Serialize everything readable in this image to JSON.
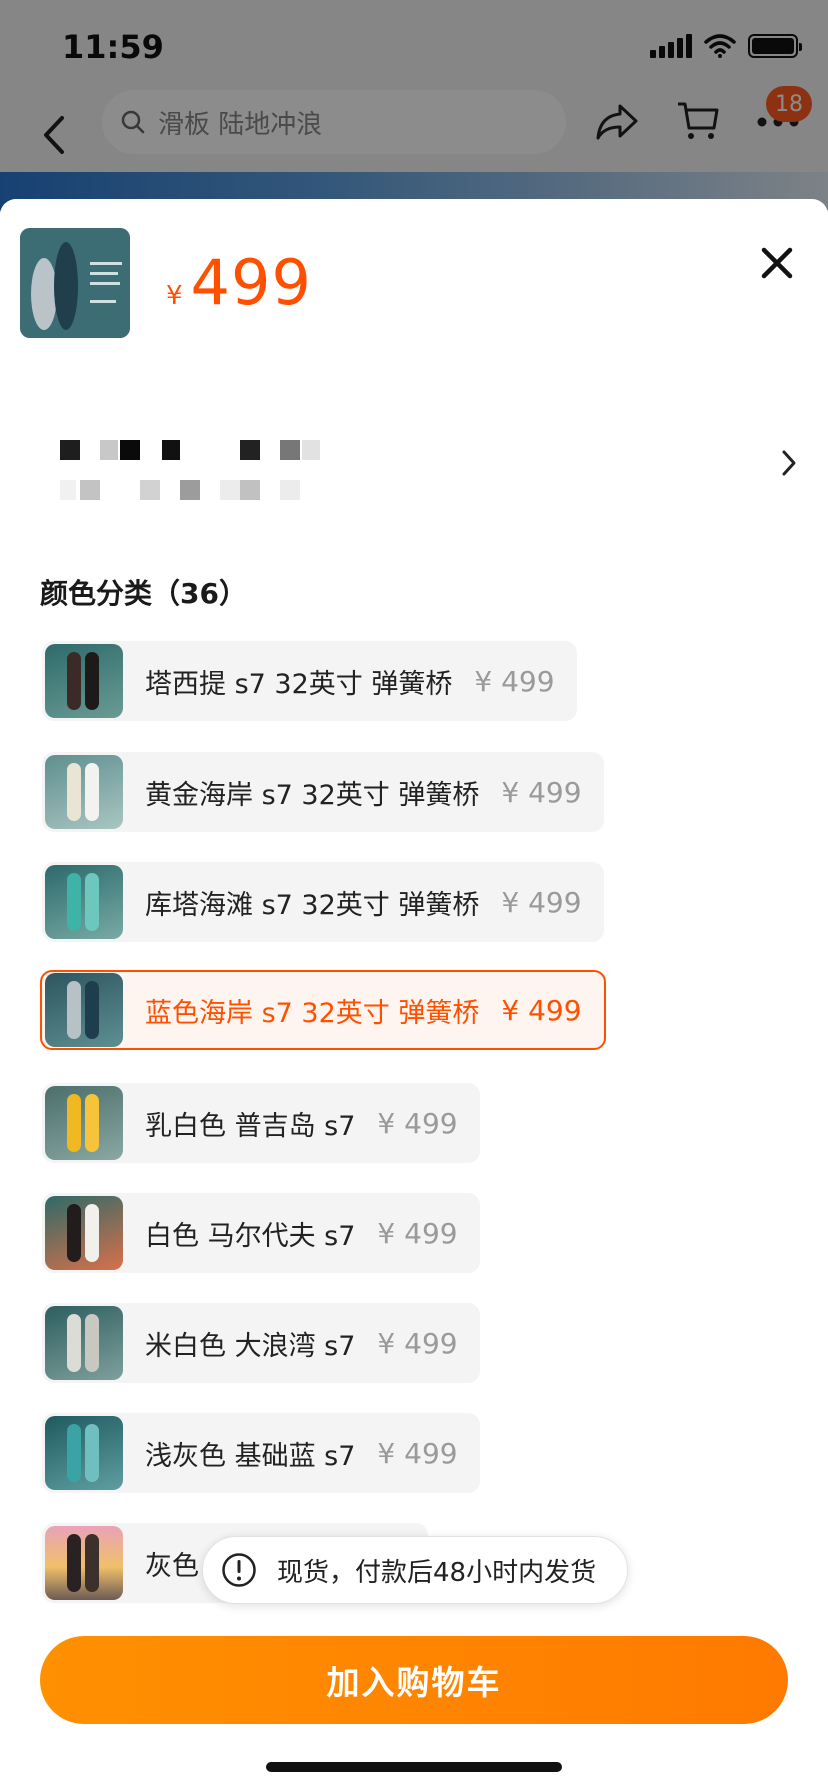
{
  "status_bar": {
    "time": "11:59"
  },
  "nav": {
    "search_placeholder": "滑板 陆地冲浪",
    "cart_badge": "18"
  },
  "product": {
    "currency": "¥",
    "price": "499",
    "thumb_label": "蓝色海岸"
  },
  "section_title": "颜色分类（36）",
  "options": [
    {
      "name": "塔西提 s7 32英寸 弹簧桥",
      "price": "¥ 499",
      "selected": false
    },
    {
      "name": "黄金海岸 s7 32英寸 弹簧桥",
      "price": "¥ 499",
      "selected": false
    },
    {
      "name": "库塔海滩 s7 32英寸 弹簧桥",
      "price": "¥ 499",
      "selected": false
    },
    {
      "name": "蓝色海岸 s7 32英寸 弹簧桥",
      "price": "¥ 499",
      "selected": true
    },
    {
      "name": "乳白色 普吉岛 s7",
      "price": "¥ 499",
      "selected": false
    },
    {
      "name": "白色 马尔代夫 s7",
      "price": "¥ 499",
      "selected": false
    },
    {
      "name": "米白色 大浪湾 s7",
      "price": "¥ 499",
      "selected": false
    },
    {
      "name": "浅灰色 基础蓝 s7",
      "price": "¥ 499",
      "selected": false
    },
    {
      "name": "灰色",
      "price": "",
      "selected": false
    }
  ],
  "toast": {
    "text": "现货，付款后48小时内发货"
  },
  "add_to_cart": "加入购物车",
  "colors": {
    "accent": "#ff5000",
    "button": "#ff8a00",
    "badge": "#ff5a1f"
  }
}
